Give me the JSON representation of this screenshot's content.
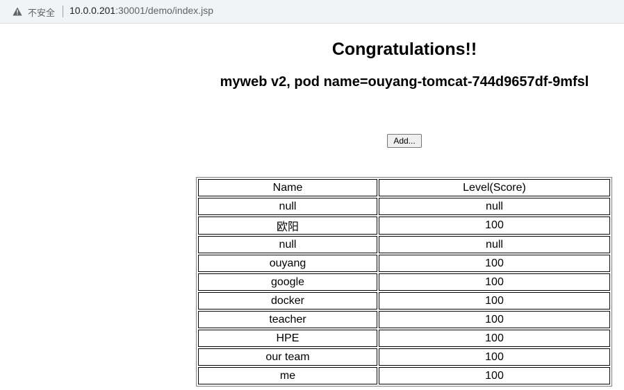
{
  "browser": {
    "security_label": "不安全",
    "url_host": "10.0.0.201",
    "url_rest": ":30001/demo/index.jsp"
  },
  "page": {
    "title": "Congratulations!!",
    "pod_info": "myweb v2, pod name=ouyang-tomcat-744d9657df-9mfsl",
    "add_button": "Add..."
  },
  "table": {
    "headers": [
      "Name",
      "Level(Score)"
    ],
    "rows": [
      [
        "null",
        "null"
      ],
      [
        "欧阳",
        "100"
      ],
      [
        "null",
        "null"
      ],
      [
        "ouyang",
        "100"
      ],
      [
        "google",
        "100"
      ],
      [
        "docker",
        "100"
      ],
      [
        "teacher",
        "100"
      ],
      [
        "HPE",
        "100"
      ],
      [
        "our team",
        "100"
      ],
      [
        "me",
        "100"
      ]
    ]
  }
}
